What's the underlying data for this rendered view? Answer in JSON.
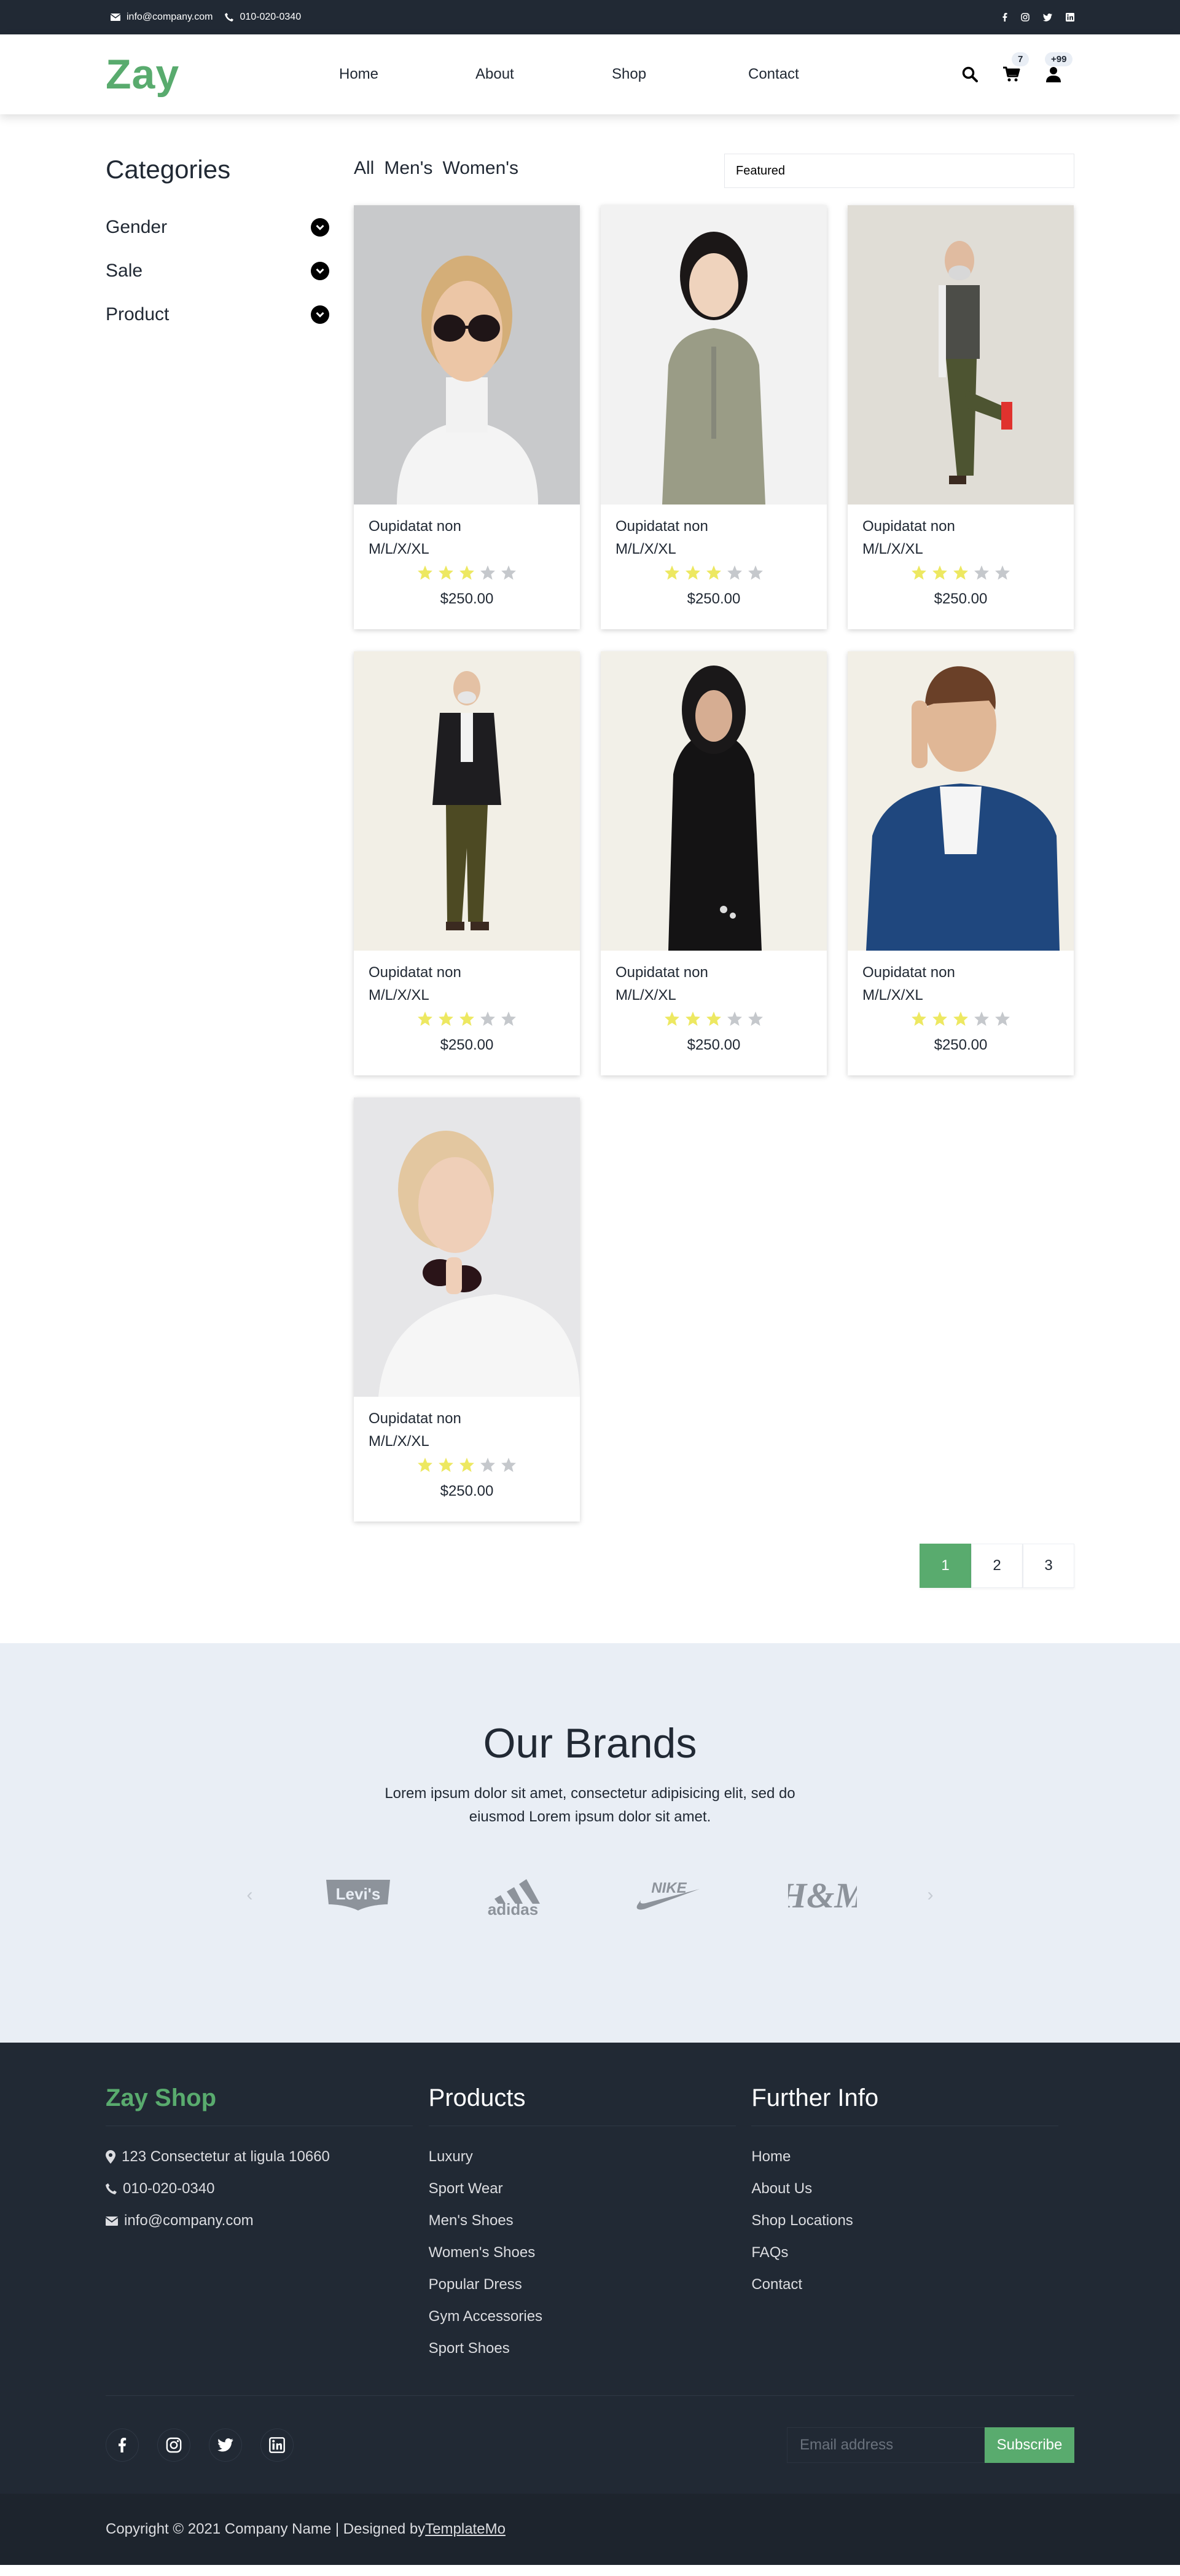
{
  "topbar": {
    "email": "info@company.com",
    "phone": "010-020-0340",
    "social_icons": [
      "facebook-icon",
      "instagram-icon",
      "twitter-icon",
      "linkedin-icon"
    ]
  },
  "header": {
    "logo": "Zay",
    "nav": [
      "Home",
      "About",
      "Shop",
      "Contact"
    ],
    "cart_count": "7",
    "user_count": "+99"
  },
  "sidebar": {
    "title": "Categories",
    "items": [
      "Gender",
      "Sale",
      "Product"
    ]
  },
  "filters": {
    "tabs": [
      "All",
      "Men's",
      "Women's"
    ],
    "sort": "Featured"
  },
  "products": [
    {
      "name": "Oupidatat non",
      "sizes": "M/L/X/XL",
      "rating": 3,
      "price": "$250.00",
      "image": "woman-sunglasses"
    },
    {
      "name": "Oupidatat non",
      "sizes": "M/L/X/XL",
      "rating": 3,
      "price": "$250.00",
      "image": "woman-green-dress"
    },
    {
      "name": "Oupidatat non",
      "sizes": "M/L/X/XL",
      "rating": 3,
      "price": "$250.00",
      "image": "man-yoga-pose"
    },
    {
      "name": "Oupidatat non",
      "sizes": "M/L/X/XL",
      "rating": 3,
      "price": "$250.00",
      "image": "man-black-blazer"
    },
    {
      "name": "Oupidatat non",
      "sizes": "M/L/X/XL",
      "rating": 3,
      "price": "$250.00",
      "image": "woman-black-abaya"
    },
    {
      "name": "Oupidatat non",
      "sizes": "M/L/X/XL",
      "rating": 3,
      "price": "$250.00",
      "image": "man-blue-suit-phone"
    },
    {
      "name": "Oupidatat non",
      "sizes": "M/L/X/XL",
      "rating": 3,
      "price": "$250.00",
      "image": "woman-holding-sunglasses"
    }
  ],
  "pagination": {
    "pages": [
      "1",
      "2",
      "3"
    ],
    "active": "1"
  },
  "brands": {
    "title": "Our Brands",
    "text": "Lorem ipsum dolor sit amet, consectetur adipisicing elit, sed do eiusmod Lorem ipsum dolor sit amet.",
    "logos": [
      "Levi's",
      "adidas",
      "NIKE",
      "H&M"
    ]
  },
  "footer": {
    "shop_title": "Zay Shop",
    "address": "123 Consectetur at ligula 10660",
    "phone": "010-020-0340",
    "email": "info@company.com",
    "products_title": "Products",
    "products": [
      "Luxury",
      "Sport Wear",
      "Men's Shoes",
      "Women's Shoes",
      "Popular Dress",
      "Gym Accessories",
      "Sport Shoes"
    ],
    "info_title": "Further Info",
    "info": [
      "Home",
      "About Us",
      "Shop Locations",
      "FAQs",
      "Contact"
    ],
    "email_placeholder": "Email address",
    "subscribe": "Subscribe",
    "copyright": "Copyright © 2021 Company Name | Designed by ",
    "designer": "TemplateMo"
  },
  "colors": {
    "accent": "#59ab6e",
    "dark": "#212934",
    "star_on": "#ede861",
    "star_off": "#c5c8cc",
    "brands_bg": "#e9eef5"
  }
}
